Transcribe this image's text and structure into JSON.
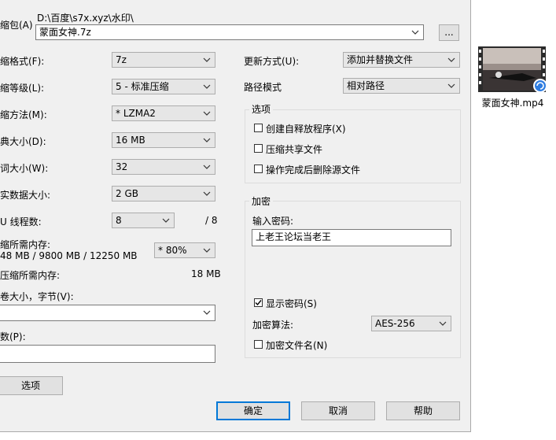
{
  "archive": {
    "label": "缩包(A)",
    "path": "D:\\百度\\s7x.xyz\\水印\\",
    "filename": "蒙面女神.7z",
    "browse_label": "..."
  },
  "left": {
    "format_label": "缩格式(F):",
    "format_value": "7z",
    "level_label": "缩等级(L):",
    "level_value": "5 - 标准压缩",
    "method_label": "缩方法(M):",
    "method_value": "* LZMA2",
    "dict_label": "典大小(D):",
    "dict_value": "16 MB",
    "word_label": "词大小(W):",
    "word_value": "32",
    "solid_label": "实数据大小:",
    "solid_value": "2 GB",
    "threads_label": "U 线程数:",
    "threads_value": "8",
    "threads_total": "/ 8",
    "mem_compress_label": "缩所需内存:",
    "mem_compress_value": "48 MB / 9800 MB / 12250 MB",
    "mem_percent": "* 80%",
    "mem_decompress_label": "压缩所需内存:",
    "mem_decompress_value": "18 MB",
    "volume_label": "卷大小，字节(V):",
    "volume_value": "",
    "params_label": "数(P):",
    "params_value": "",
    "options_button": "选项"
  },
  "right": {
    "update_label": "更新方式(U):",
    "update_value": "添加并替换文件",
    "path_label": "路径模式",
    "path_value": "相对路径",
    "options_group": "选项",
    "opt_sfx": "创建自释放程序(X)",
    "opt_shared": "压缩共享文件",
    "opt_delete": "操作完成后删除源文件",
    "encrypt_group": "加密",
    "password_label": "输入密码:",
    "password_value": "上老王论坛当老王",
    "show_password": "显示密码(S)",
    "enc_method_label": "加密算法:",
    "enc_method_value": "AES-256",
    "enc_names": "加密文件名(N)"
  },
  "buttons": {
    "ok": "确定",
    "cancel": "取消",
    "help": "帮助"
  },
  "desktop": {
    "file_name": "蒙面女神.mp4"
  }
}
